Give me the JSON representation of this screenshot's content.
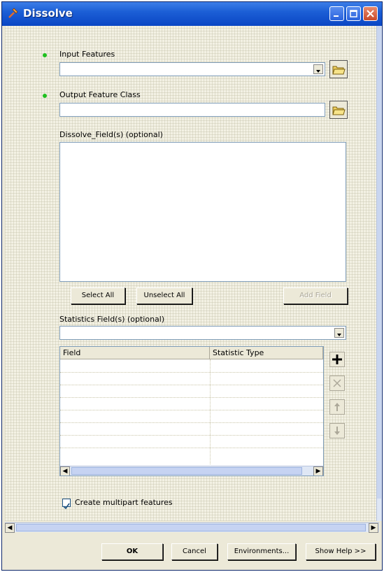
{
  "window": {
    "title": "Dissolve"
  },
  "form": {
    "input_features_label": "Input Features",
    "input_features_value": "",
    "output_class_label": "Output Feature Class",
    "output_class_value": "",
    "dissolve_label": "Dissolve_Field(s) (optional)",
    "select_all": "Select All",
    "unselect_all": "Unselect All",
    "add_field": "Add Field",
    "stats_label": "Statistics Field(s) (optional)",
    "stats_value": "",
    "table_headers": [
      "Field",
      "Statistic Type"
    ],
    "multipart_label": "Create multipart features",
    "multipart_checked": true
  },
  "buttons": {
    "ok": "OK",
    "cancel": "Cancel",
    "environments": "Environments...",
    "show_help": "Show Help >>"
  },
  "icons": {
    "folder": "folder-icon",
    "add": "plus-icon",
    "remove": "x-icon",
    "up": "up-arrow-icon",
    "down": "down-arrow-icon"
  },
  "colors": {
    "titlebar": "#0a46c4",
    "required_dot": "#1fc01f"
  }
}
